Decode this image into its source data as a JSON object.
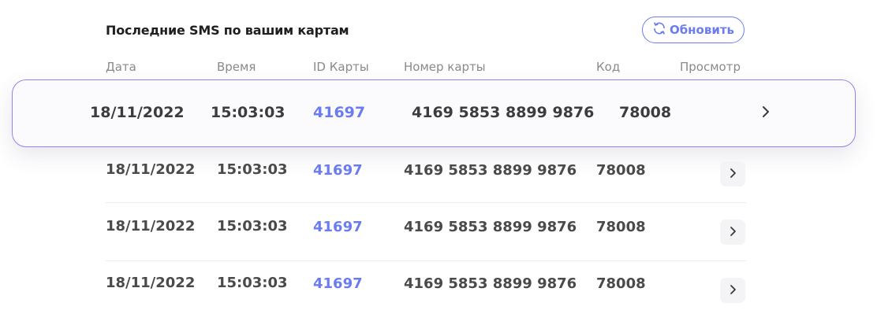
{
  "section": {
    "title": "Последние SMS по вашим картам",
    "refresh_label": "Обновить"
  },
  "columns": [
    "Дата",
    "Время",
    "ID Карты",
    "Номер карты",
    "Код",
    "Просмотр"
  ],
  "rows": [
    {
      "date": "18/11/2022",
      "time": "15:03:03",
      "card_id": "41697",
      "card_number": "4169 5853 8899 9876",
      "code": "78008",
      "highlighted": true
    },
    {
      "date": "18/11/2022",
      "time": "15:03:03",
      "card_id": "41697",
      "card_number": "4169 5853 8899 9876",
      "code": "78008"
    },
    {
      "date": "18/11/2022",
      "time": "15:03:03",
      "card_id": "41697",
      "card_number": "4169 5853 8899 9876",
      "code": "78008"
    },
    {
      "date": "18/11/2022",
      "time": "15:03:03",
      "card_id": "41697",
      "card_number": "4169 5853 8899 9876",
      "code": "78008"
    }
  ],
  "icons": {
    "refresh": "refresh-icon",
    "view": "chevron-right-icon"
  },
  "colors": {
    "accent": "#6b7cf0",
    "highlight_border": "#8f86ec"
  }
}
